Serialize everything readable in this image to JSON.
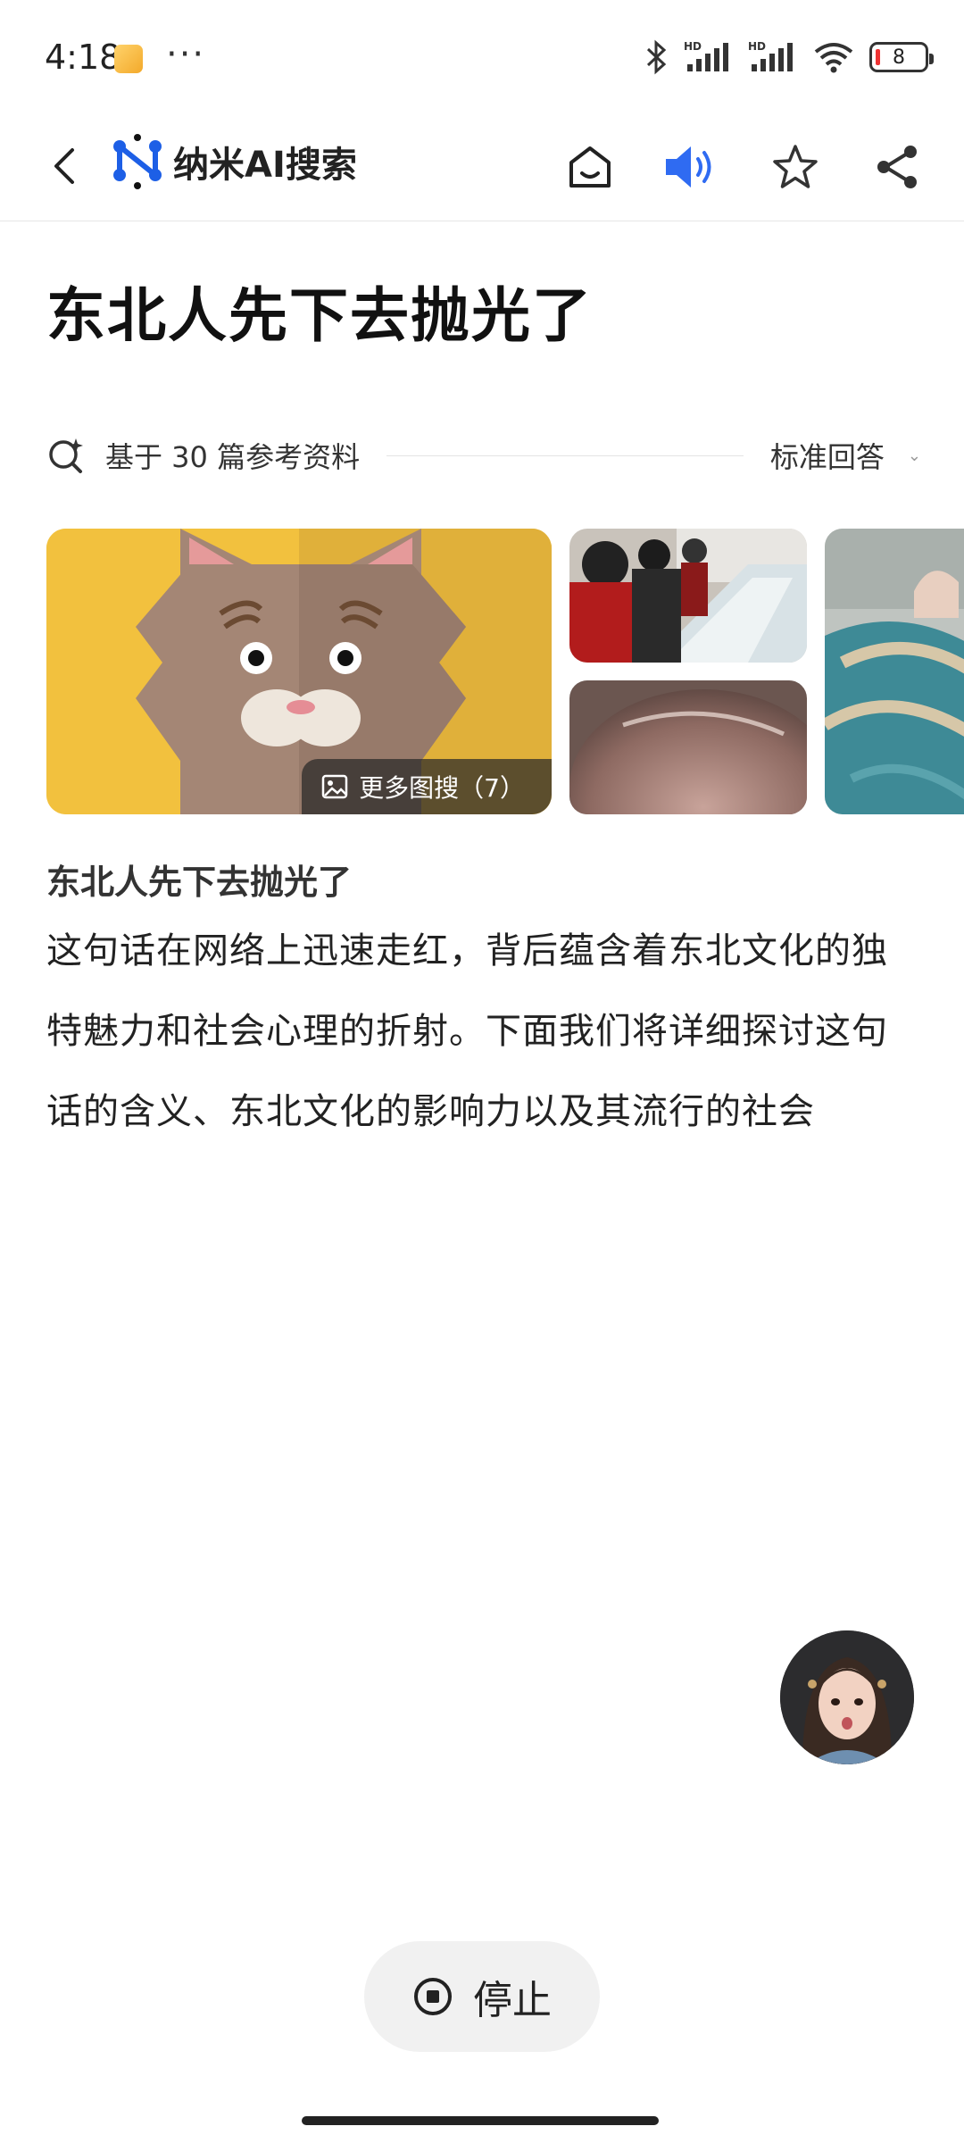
{
  "status_bar": {
    "time": "4:18",
    "dots": "···",
    "battery_level": "8",
    "signal_label_1": "HD",
    "signal_label_2": "HD"
  },
  "header": {
    "app_title": "纳米AI搜索",
    "speaker_color": "#2f6bf2"
  },
  "question": {
    "title": "东北人先下去抛光了"
  },
  "references": {
    "summary": "基于 30 篇参考资料",
    "mode": "标准回答"
  },
  "images": {
    "more_label": "更多图搜（7）"
  },
  "answer": {
    "heading": "东北人先下去抛光了",
    "body": "这句话在网络上迅速走红，背后蕴含着东北文化的独特魅力和社会心理的折射。下面我们将详细探讨这句话的含义、东北文化的影响力以及其流行的社会"
  },
  "controls": {
    "stop_label": "停止"
  }
}
